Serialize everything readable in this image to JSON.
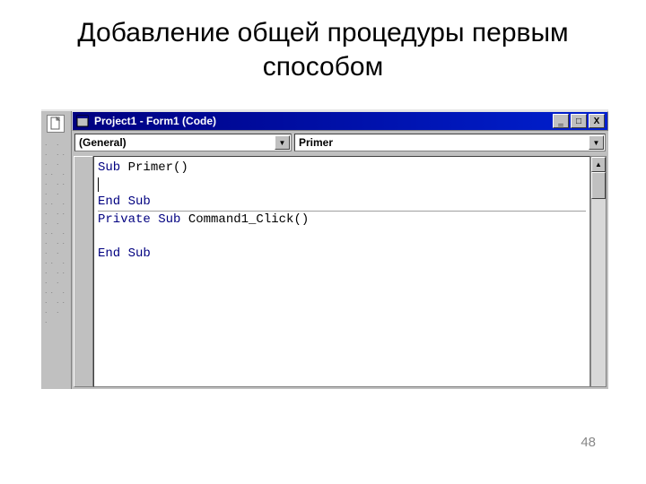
{
  "slide": {
    "title": "Добавление общей процедуры первым способом",
    "page_number": "48"
  },
  "window": {
    "title": "Project1 - Form1 (Code)",
    "minimize": "‗",
    "maximize": "□",
    "close": "X"
  },
  "dropdowns": {
    "object": "(General)",
    "procedure": "Primer"
  },
  "code": {
    "line1_kw": "Sub",
    "line1_rest": " Primer()",
    "line3_kw": "End Sub",
    "line4_kw": "Private Sub",
    "line4_rest": " Command1_Click()",
    "line6_kw": "End Sub"
  }
}
